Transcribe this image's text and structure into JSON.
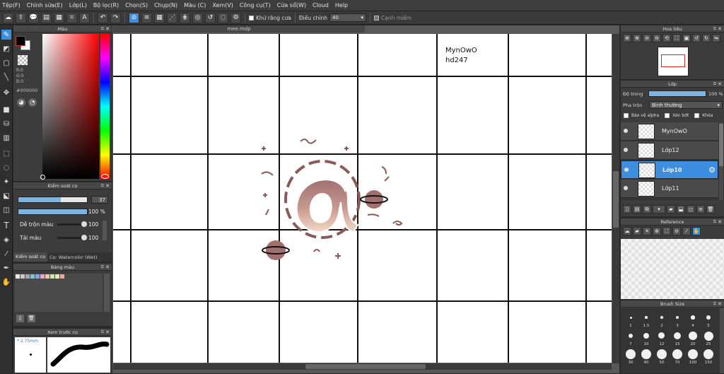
{
  "menu": [
    "Tệp(F)",
    "Chỉnh sửa(E)",
    "Lớp(L)",
    "Bộ lọc(R)",
    "Chọn(S)",
    "Chụp(N)",
    "Màu (C)",
    "Xem(V)",
    "Công cụ(T)",
    "Cửa sổ(W)",
    "Cloud",
    "Help"
  ],
  "toolbar": {
    "antialias_label": "Khử răng cưa",
    "adjust_label": "Điều chỉnh",
    "adjust_value": "40",
    "edge_label": "Cạnh miếm"
  },
  "document": {
    "tab_title": "mee.mdp"
  },
  "canvas_text": {
    "line1": "MynOwO",
    "line2": "hd247"
  },
  "color_panel": {
    "title": "Màu",
    "r": "R:0",
    "g": "G:0",
    "b": "B:0",
    "hex": "#000000",
    "primary": "#000000",
    "secondary": "#ffffff"
  },
  "brush_control": {
    "title": "Kiểm soát cọ",
    "size_value": "37",
    "size_fraction": 0.62,
    "opacity_value": "100 %",
    "opacity_fraction": 1.0,
    "blend_label": "Dễ trộn màu",
    "blend_value": "100",
    "blend_fraction": 0.95,
    "reload_label": "Tải màu",
    "reload_value": "100",
    "reload_fraction": 0.95,
    "tab_label": "Kiểm soát cọ",
    "brush_name": "Cọ: Watercolor (Wet)"
  },
  "swatch_panel": {
    "title": "Bảng màu",
    "colors": [
      "#e8e8e8",
      "#c8c8c8",
      "#a8a8a8",
      "#7ec8c8",
      "#7ea8e8",
      "#e8a8c8",
      "#e8c8a8",
      "#c8e8a8",
      "#e8e8a8",
      "#e8a8a8"
    ]
  },
  "brush_preview": {
    "title": "Xem trước cọ",
    "size": "2.75mm"
  },
  "navigator": {
    "title": "Hoa tiêu"
  },
  "layer_panel": {
    "title": "Lớp",
    "opacity_label": "Độ trong",
    "opacity_value": "100 %",
    "blend_label": "Pha trộn",
    "blend_value": "Bình thường",
    "protect_alpha": "Bảo vệ alpha",
    "clipping": "Xén bớt",
    "lock": "Khóa",
    "layers": [
      {
        "name": "MynOwO"
      },
      {
        "name": "Lớp12"
      },
      {
        "name": "Lớp10"
      },
      {
        "name": "Lớp11"
      }
    ]
  },
  "reference_panel": {
    "title": "Reference"
  },
  "brush_size_panel": {
    "title": "Brush Size",
    "sizes": [
      "1",
      "1.5",
      "2",
      "3",
      "4",
      "5",
      "7",
      "10",
      "12",
      "15",
      "20",
      "25",
      "30",
      "40",
      "50",
      "70",
      "100",
      "150"
    ]
  }
}
